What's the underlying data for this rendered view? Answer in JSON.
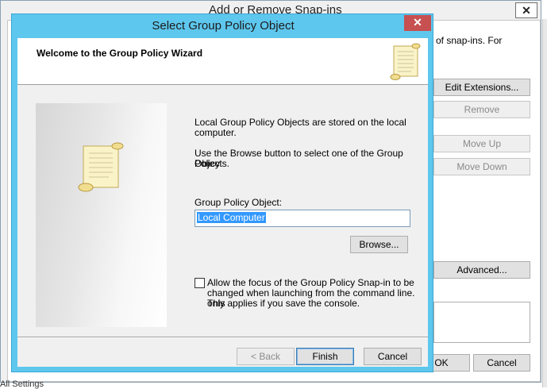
{
  "background_dialog": {
    "title": "Add or Remove Snap-ins",
    "close_glyph": "✕",
    "description": "of snap-ins. For",
    "buttons": {
      "edit_extensions": "Edit Extensions...",
      "remove": "Remove",
      "move_up": "Move Up",
      "move_down": "Move Down",
      "advanced": "Advanced...",
      "ok": "OK",
      "cancel": "Cancel"
    },
    "bottom_fragment": "All Settings"
  },
  "wizard": {
    "title": "Select Group Policy Object",
    "close_glyph": "✕",
    "heading": "Welcome to the Group Policy Wizard",
    "intro_line1": "Local Group Policy Objects are stored on the local",
    "intro_line2": "computer.",
    "browse_line1": "Use the Browse button to select one of the Group Policy",
    "browse_line2": "Objects.",
    "gpo_label": "Group Policy Object:",
    "gpo_value": "Local Computer",
    "browse_button": "Browse...",
    "checkbox_line1": "Allow the focus of the Group Policy Snap-in to be",
    "checkbox_line2": "changed when launching from the command line.  This",
    "checkbox_line3": "only applies if you save the console.",
    "checkbox_checked": false,
    "back_button": "< Back",
    "finish_button": "Finish",
    "cancel_button": "Cancel"
  },
  "colors": {
    "titlebar": "#5ec7ee",
    "close_button": "#c75050",
    "selection": "#3399ff"
  }
}
